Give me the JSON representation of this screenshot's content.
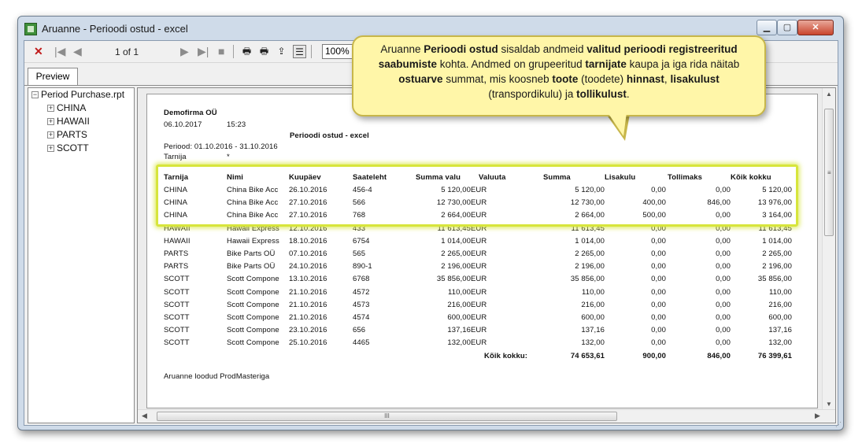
{
  "window": {
    "title": "Aruanne - Perioodi ostud - excel"
  },
  "toolbar": {
    "page_indicator": "1 of 1",
    "zoom": "100%"
  },
  "tabs": {
    "preview": "Preview"
  },
  "tree": {
    "root": "Period Purchase.rpt",
    "children": [
      "CHINA",
      "HAWAII",
      "PARTS",
      "SCOTT"
    ]
  },
  "report": {
    "company": "Demofirma OÜ",
    "date": "06.10.2017",
    "time": "15:23",
    "title": "Perioodi ostud - excel",
    "period_line": "Periood: 01.10.2016 - 31.10.2016",
    "supplier_label": "Tarnija",
    "supplier_value": "*",
    "headers": [
      "Tarnija",
      "Nimi",
      "Kuupäev",
      "Saateleht",
      "Summa valu",
      "Valuuta",
      "Summa",
      "Lisakulu",
      "Tollimaks",
      "Kõik kokku"
    ],
    "rows": [
      [
        "CHINA",
        "China Bike Acc",
        "26.10.2016",
        "456-4",
        "5 120,00",
        "EUR",
        "5 120,00",
        "0,00",
        "0,00",
        "5 120,00"
      ],
      [
        "CHINA",
        "China Bike Acc",
        "27.10.2016",
        "566",
        "12 730,00",
        "EUR",
        "12 730,00",
        "400,00",
        "846,00",
        "13 976,00"
      ],
      [
        "CHINA",
        "China Bike Acc",
        "27.10.2016",
        "768",
        "2 664,00",
        "EUR",
        "2 664,00",
        "500,00",
        "0,00",
        "3 164,00"
      ],
      [
        "HAWAII",
        "Hawaii Express",
        "12.10.2016",
        "433",
        "11 613,45",
        "EUR",
        "11 613,45",
        "0,00",
        "0,00",
        "11 613,45"
      ],
      [
        "HAWAII",
        "Hawaii Express",
        "18.10.2016",
        "6754",
        "1 014,00",
        "EUR",
        "1 014,00",
        "0,00",
        "0,00",
        "1 014,00"
      ],
      [
        "PARTS",
        "Bike Parts OÜ",
        "07.10.2016",
        "565",
        "2 265,00",
        "EUR",
        "2 265,00",
        "0,00",
        "0,00",
        "2 265,00"
      ],
      [
        "PARTS",
        "Bike Parts OÜ",
        "24.10.2016",
        "890-1",
        "2 196,00",
        "EUR",
        "2 196,00",
        "0,00",
        "0,00",
        "2 196,00"
      ],
      [
        "SCOTT",
        "Scott Compone",
        "13.10.2016",
        "6768",
        "35 856,00",
        "EUR",
        "35 856,00",
        "0,00",
        "0,00",
        "35 856,00"
      ],
      [
        "SCOTT",
        "Scott Compone",
        "21.10.2016",
        "4572",
        "110,00",
        "EUR",
        "110,00",
        "0,00",
        "0,00",
        "110,00"
      ],
      [
        "SCOTT",
        "Scott Compone",
        "21.10.2016",
        "4573",
        "216,00",
        "EUR",
        "216,00",
        "0,00",
        "0,00",
        "216,00"
      ],
      [
        "SCOTT",
        "Scott Compone",
        "21.10.2016",
        "4574",
        "600,00",
        "EUR",
        "600,00",
        "0,00",
        "0,00",
        "600,00"
      ],
      [
        "SCOTT",
        "Scott Compone",
        "23.10.2016",
        "656",
        "137,16",
        "EUR",
        "137,16",
        "0,00",
        "0,00",
        "137,16"
      ],
      [
        "SCOTT",
        "Scott Compone",
        "25.10.2016",
        "4465",
        "132,00",
        "EUR",
        "132,00",
        "0,00",
        "0,00",
        "132,00"
      ]
    ],
    "total_label": "Kõik kokku:",
    "totals": [
      "74 653,61",
      "900,00",
      "846,00",
      "76 399,61"
    ],
    "footer": "Aruanne loodud ProdMasteriga"
  },
  "callout": {
    "segments": [
      {
        "t": "Aruanne ",
        "b": false
      },
      {
        "t": "Perioodi ostud",
        "b": true
      },
      {
        "t": " sisaldab andmeid ",
        "b": false
      },
      {
        "t": "valitud perioodi registreeritud saabumiste",
        "b": true
      },
      {
        "t": " kohta.  Andmed on grupeeritud ",
        "b": false
      },
      {
        "t": "tarnijate",
        "b": true
      },
      {
        "t": " kaupa ja iga rida näitab ",
        "b": false
      },
      {
        "t": "ostuarve",
        "b": true
      },
      {
        "t": " summat, mis koosneb ",
        "b": false
      },
      {
        "t": "toote",
        "b": true
      },
      {
        "t": " (toodete) ",
        "b": false
      },
      {
        "t": "hinnast",
        "b": true
      },
      {
        "t": ", ",
        "b": false
      },
      {
        "t": "lisakulust",
        "b": true
      },
      {
        "t": " (transpordikulu) ja ",
        "b": false
      },
      {
        "t": "tollikulust",
        "b": true
      },
      {
        "t": ".",
        "b": false
      }
    ]
  },
  "colors": {
    "highlight": "#d7e53c",
    "callout_bg": "#fff6a8",
    "close_button": "#c9452d"
  }
}
